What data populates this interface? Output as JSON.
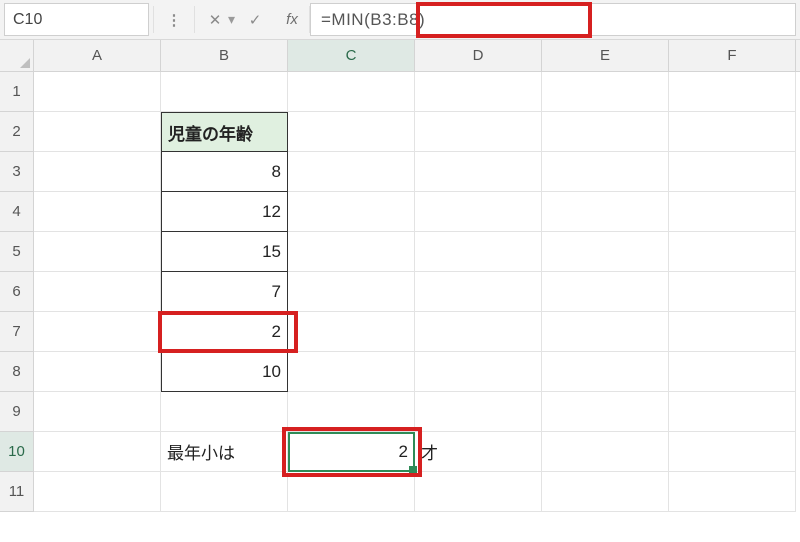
{
  "name_box": {
    "value": "C10"
  },
  "formula_bar": {
    "formula": "=MIN(B3:B8)"
  },
  "fx_label": "fx",
  "columns": [
    "A",
    "B",
    "C",
    "D",
    "E",
    "F"
  ],
  "selected_column": "C",
  "rows": [
    "1",
    "2",
    "3",
    "4",
    "5",
    "6",
    "7",
    "8",
    "9",
    "10",
    "11"
  ],
  "selected_row": "10",
  "table": {
    "header": "児童の年齢",
    "ages": [
      "8",
      "12",
      "15",
      "7",
      "2",
      "10"
    ]
  },
  "result": {
    "label": "最年小は",
    "value": "2",
    "suffix": "才"
  },
  "icons": {
    "caret": "▾",
    "colon": "⋮",
    "cancel": "✕",
    "confirm": "✓"
  }
}
